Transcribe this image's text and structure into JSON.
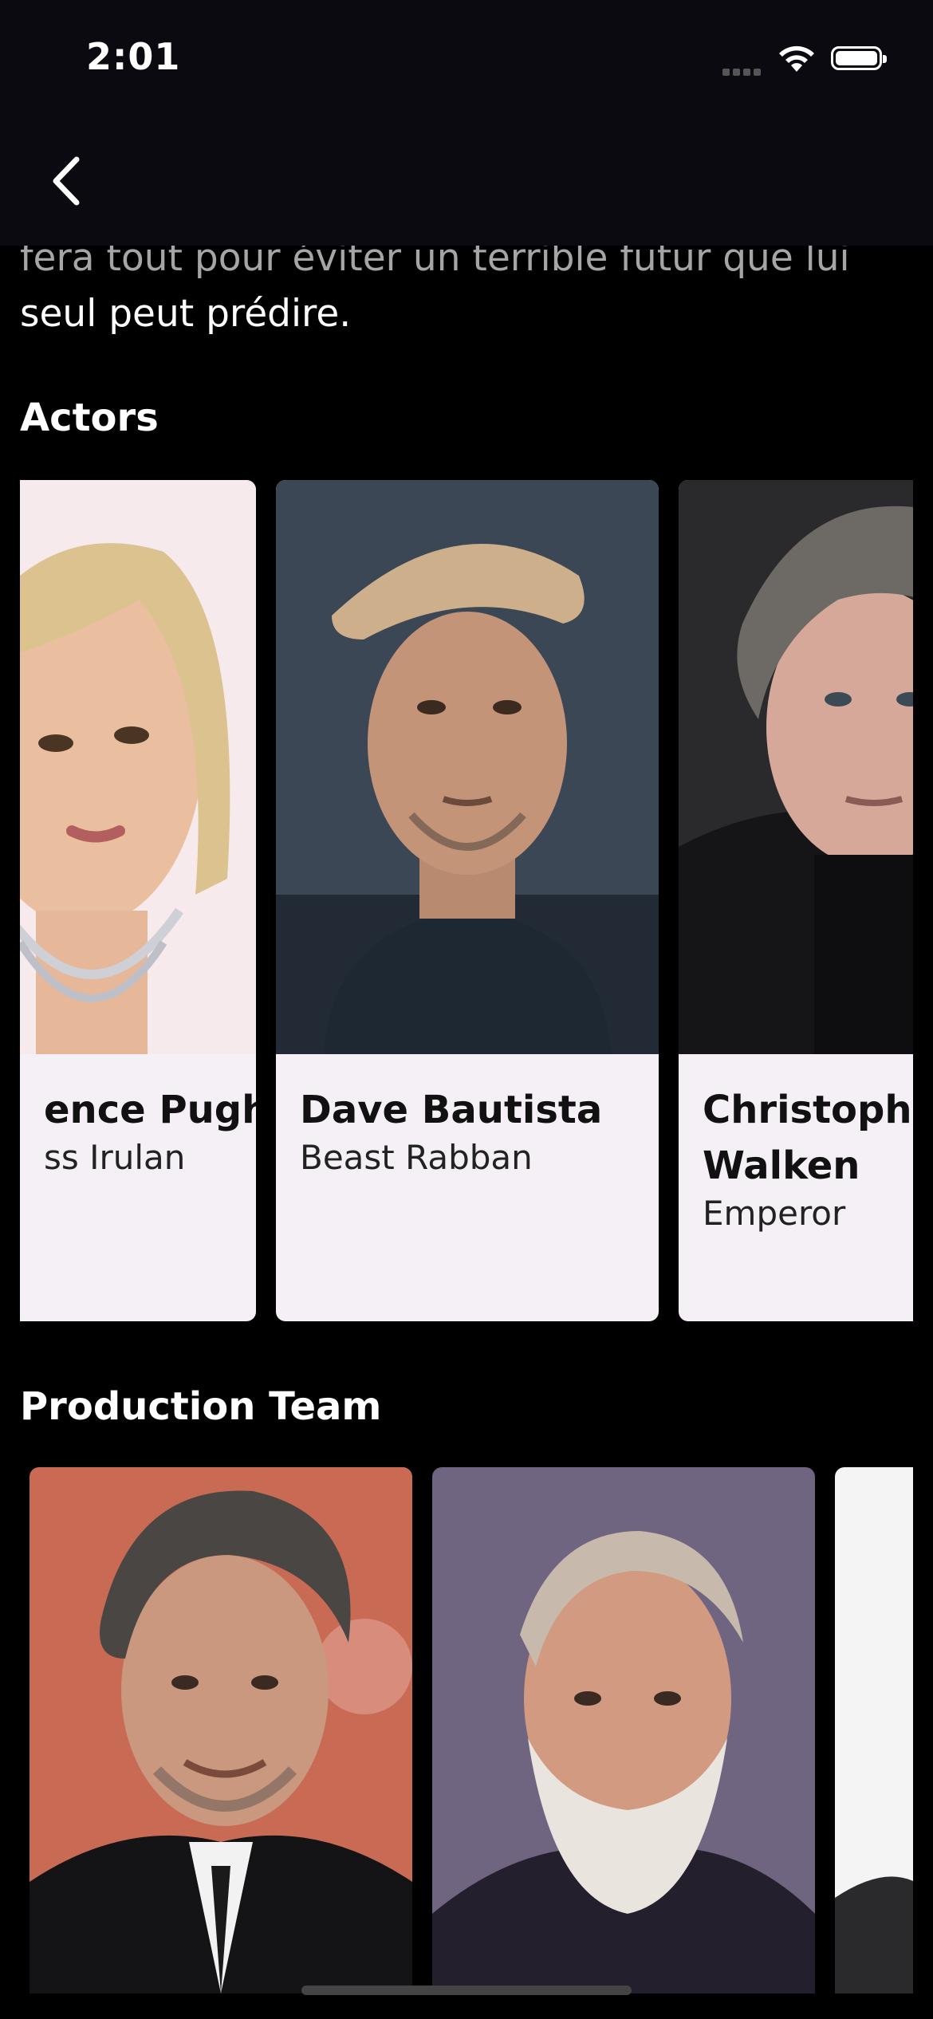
{
  "status": {
    "time": "2:01"
  },
  "nav": {
    "back_icon": "chevron-left-icon"
  },
  "overview": {
    "partial_line": "fera tout pour éviter un terrible futur que lui",
    "last_line": "seul peut prédire."
  },
  "actors": {
    "title": "Actors",
    "items": [
      {
        "name": "ence Pugh",
        "role": "ss Irulan"
      },
      {
        "name": "Dave Bautista",
        "role": "Beast Rabban"
      },
      {
        "name": "Christopher Walken",
        "role": "Emperor"
      }
    ]
  },
  "production": {
    "title": "Production Team"
  },
  "colors": {
    "background": "#000000",
    "bar": "#0a0a10",
    "card": "#f5f0f6"
  }
}
